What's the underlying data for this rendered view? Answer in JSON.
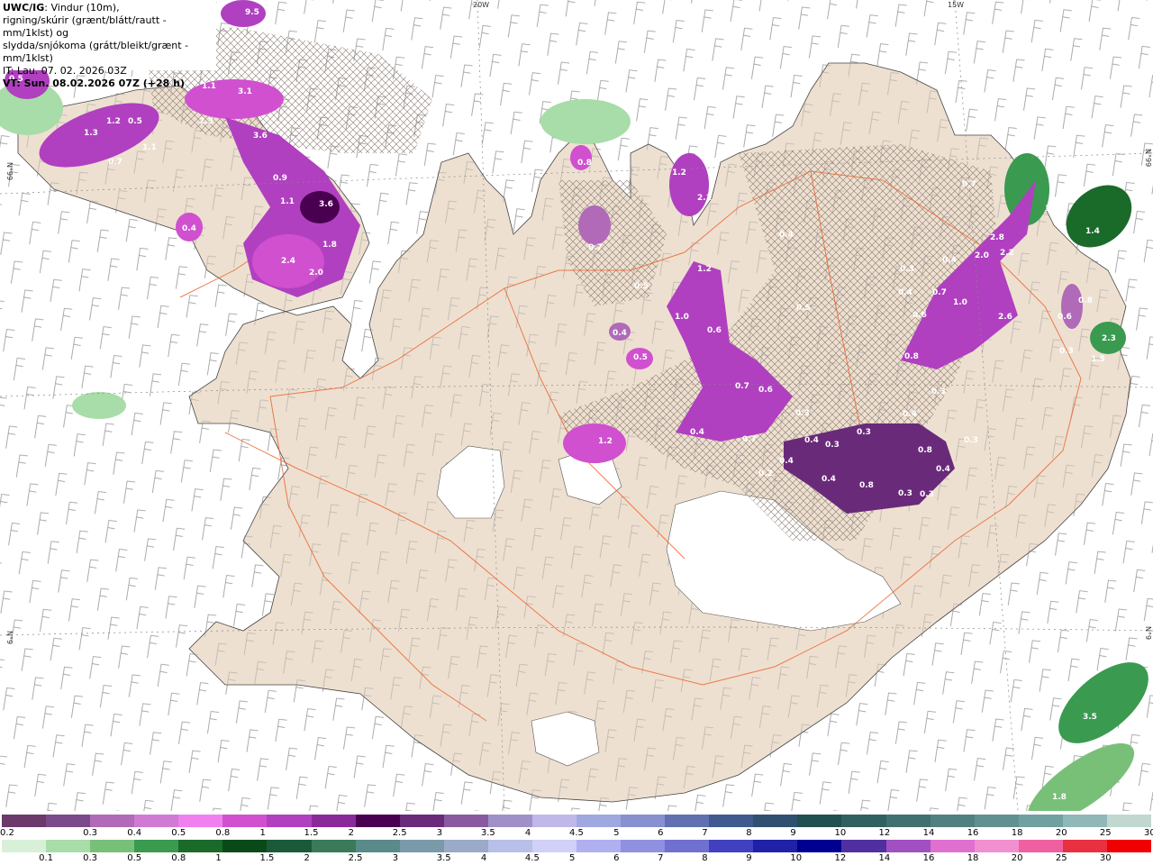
{
  "header": {
    "model": "UWC/IG",
    "line1_rest": ": Vindur (10m),",
    "line2": "rigning/skúrir (grænt/blátt/rautt - mm/1klst) og",
    "line3": "slydda/snjókoma (grátt/bleikt/grænt - mm/1klst)",
    "line4": "IT: Lau. 07. 02. 2026 03Z",
    "line5": "VT: Sun. 08.02.2026 07Z (+28 h)"
  },
  "graticule": {
    "top_labels": [
      "20W",
      "15W"
    ],
    "left_labels": [
      "N°99",
      "N°9"
    ],
    "right_labels": [
      "N°99",
      "N°9"
    ]
  },
  "colors": {
    "land": "#eee0d0",
    "sea": "#ffffff",
    "roads": "#e8602a",
    "glacier": "#ffffff",
    "snow_dark": "#6a2a7a",
    "snow_mid": "#b040c0",
    "snow_light": "#e070e8",
    "rain_green": "#3a9a50"
  },
  "precip_labels": [
    {
      "text": "9.5"
    },
    {
      "text": "0.5"
    },
    {
      "text": "3.1"
    },
    {
      "text": "1.1"
    },
    {
      "text": "2.3"
    },
    {
      "text": "1.2"
    },
    {
      "text": "1.3"
    },
    {
      "text": "0.5"
    },
    {
      "text": "0.7"
    },
    {
      "text": "1.1"
    },
    {
      "text": "3.6"
    },
    {
      "text": "0.9"
    },
    {
      "text": "1.1"
    },
    {
      "text": "3.6"
    },
    {
      "text": "0.4"
    },
    {
      "text": "1.8"
    },
    {
      "text": "2.4"
    },
    {
      "text": "2.0"
    },
    {
      "text": "0.8"
    },
    {
      "text": "1.2"
    },
    {
      "text": "2.1"
    },
    {
      "text": "0.7"
    },
    {
      "text": "0.4"
    },
    {
      "text": "0.5"
    },
    {
      "text": "1.2"
    },
    {
      "text": "0.5"
    },
    {
      "text": "1.0"
    },
    {
      "text": "0.6"
    },
    {
      "text": "0.4"
    },
    {
      "text": "0.5"
    },
    {
      "text": "0.7"
    },
    {
      "text": "0.6"
    },
    {
      "text": "1.2"
    },
    {
      "text": "0.4"
    },
    {
      "text": "0.7"
    },
    {
      "text": "0.4"
    },
    {
      "text": "0.7"
    },
    {
      "text": "2.8"
    },
    {
      "text": "2.2"
    },
    {
      "text": "2.0"
    },
    {
      "text": "0.4"
    },
    {
      "text": "0.3"
    },
    {
      "text": "0.4"
    },
    {
      "text": "0.7"
    },
    {
      "text": "1.0"
    },
    {
      "text": "0.6"
    },
    {
      "text": "2.6"
    },
    {
      "text": "0.8"
    },
    {
      "text": "0.6"
    },
    {
      "text": "0.3"
    },
    {
      "text": "0.3"
    },
    {
      "text": "0.4"
    },
    {
      "text": "0.3"
    },
    {
      "text": "0.3"
    },
    {
      "text": "0.4"
    },
    {
      "text": "0.3"
    },
    {
      "text": "0.8"
    },
    {
      "text": "0.4"
    },
    {
      "text": "0.4"
    },
    {
      "text": "0.8"
    },
    {
      "text": "0.3"
    },
    {
      "text": "0.3"
    },
    {
      "text": "0.2"
    },
    {
      "text": "1.4"
    },
    {
      "text": "1.3"
    },
    {
      "text": "2.3"
    },
    {
      "text": "1.5"
    },
    {
      "text": "0.8"
    },
    {
      "text": "0.3"
    },
    {
      "text": "3.5"
    },
    {
      "text": "1.8"
    }
  ],
  "legend_snow": {
    "labels": [
      "0.2",
      "0.3",
      "0.4",
      "0.5",
      "0.8",
      "1",
      "1.5",
      "2",
      "2.5",
      "3",
      "3.5",
      "4",
      "4.5",
      "5",
      "6",
      "7",
      "8",
      "9",
      "10",
      "12",
      "14",
      "16",
      "18",
      "20",
      "25",
      "30"
    ],
    "colors": [
      "#6b3a6b",
      "#7a4a8a",
      "#b06ab8",
      "#d07ad6",
      "#f080f0",
      "#d050d0",
      "#b040c0",
      "#8a2a9a",
      "#4a0050",
      "#6a2a7a",
      "#8a5aa0",
      "#a090c8",
      "#c0b8e8",
      "#a0a8e0",
      "#8890d0",
      "#6070b0",
      "#405a90",
      "#305070",
      "#205050",
      "#306060",
      "#407070",
      "#508080",
      "#609090",
      "#70a0a0",
      "#90b8b8",
      "#c0d8d0"
    ]
  },
  "legend_rain": {
    "labels": [
      "0.1",
      "0.3",
      "0.5",
      "0.8",
      "1",
      "1.5",
      "2",
      "2.5",
      "3",
      "3.5",
      "4",
      "4.5",
      "5",
      "6",
      "7",
      "8",
      "9",
      "10",
      "12",
      "14",
      "16",
      "18",
      "20",
      "25",
      "30"
    ],
    "colors": [
      "#d8f0d8",
      "#a8dca8",
      "#78c078",
      "#3a9a50",
      "#1a6a2a",
      "#0a4a1a",
      "#1a5a3a",
      "#3a7a5a",
      "#5a8a8a",
      "#7a9aaa",
      "#9aaac8",
      "#b8c0e8",
      "#d0d0f8",
      "#b0b0f0",
      "#9090e0",
      "#7070d0",
      "#4040c0",
      "#2020a8",
      "#000090",
      "#5030a0",
      "#a050c0",
      "#e070d0",
      "#f090d0",
      "#f060a0",
      "#e83040",
      "#f00000"
    ]
  }
}
